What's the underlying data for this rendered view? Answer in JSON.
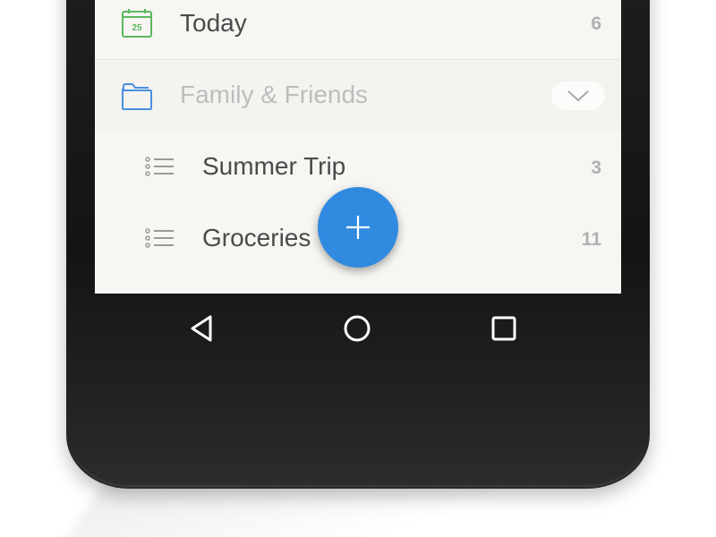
{
  "lists": {
    "today": {
      "label": "Today",
      "count": "6",
      "date_badge": "25"
    },
    "folder": {
      "label": "Family & Friends"
    },
    "items": [
      {
        "label": "Summer Trip",
        "count": "3"
      },
      {
        "label": "Groceries",
        "count": "11"
      }
    ]
  },
  "colors": {
    "accent": "#2f8ae0",
    "today_icon": "#5cb85c",
    "folder_icon": "#4a90e2"
  },
  "icons": {
    "today": "calendar-icon",
    "folder": "folder-icon",
    "list": "list-icon",
    "expand": "chevron-down-icon",
    "fab": "plus-icon",
    "nav_back": "back-triangle-icon",
    "nav_home": "home-circle-icon",
    "nav_recent": "recent-square-icon"
  }
}
